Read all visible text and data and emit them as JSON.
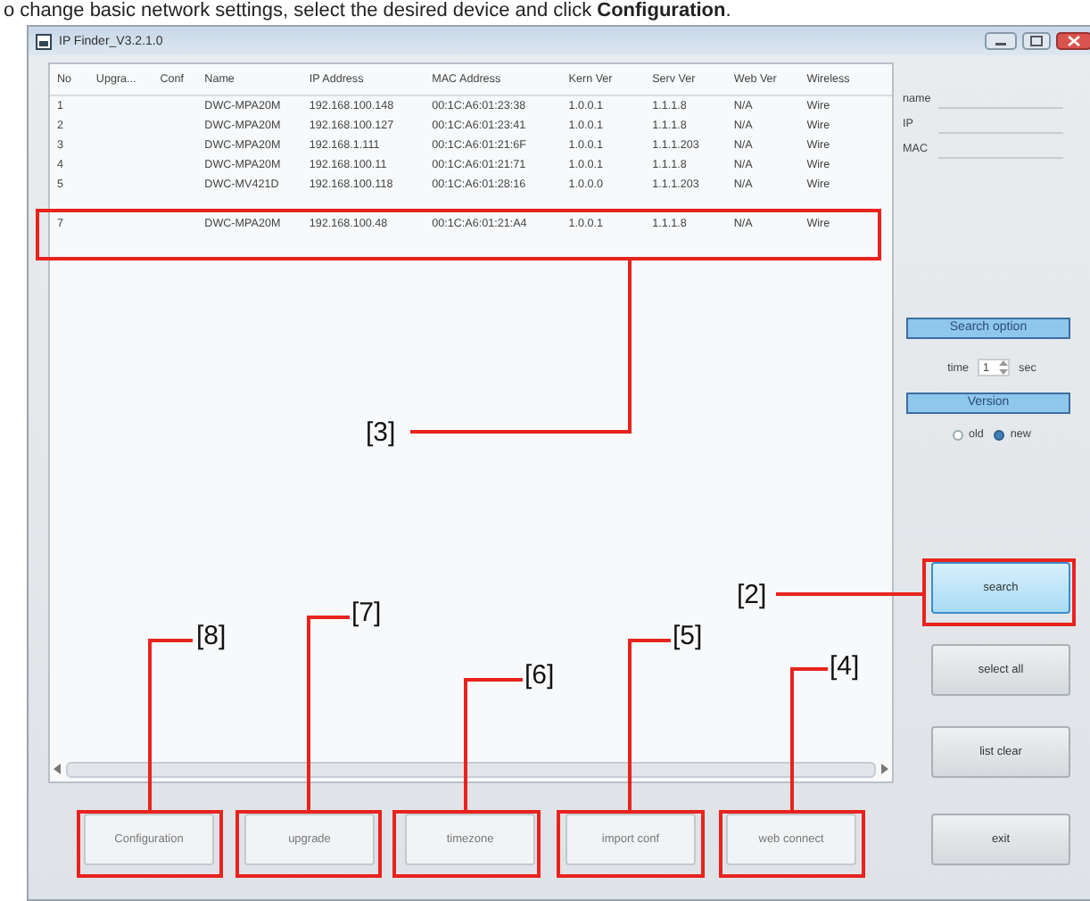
{
  "caption": "o change basic network settings, select the desired device and click **Configuration**.",
  "window": {
    "title": "IP Finder_V3.2.1.0"
  },
  "table": {
    "columns": [
      "No",
      "Upgra...",
      "Conf",
      "Name",
      "IP Address",
      "MAC Address",
      "Kern Ver",
      "Serv Ver",
      "Web Ver",
      "Wireless"
    ],
    "rows": [
      {
        "no": "1",
        "name": "DWC-MPA20M",
        "ip": "192.168.100.148",
        "mac": "00:1C:A6:01:23:38",
        "kern": "1.0.0.1",
        "serv": "1.1.1.8",
        "web": "N/A",
        "wireless": "Wire"
      },
      {
        "no": "2",
        "name": "DWC-MPA20M",
        "ip": "192.168.100.127",
        "mac": "00:1C:A6:01:23:41",
        "kern": "1.0.0.1",
        "serv": "1.1.1.8",
        "web": "N/A",
        "wireless": "Wire"
      },
      {
        "no": "3",
        "name": "DWC-MPA20M",
        "ip": "192.168.1.111",
        "mac": "00:1C:A6:01:21:6F",
        "kern": "1.0.0.1",
        "serv": "1.1.1.203",
        "web": "N/A",
        "wireless": "Wire"
      },
      {
        "no": "4",
        "name": "DWC-MPA20M",
        "ip": "192.168.100.11",
        "mac": "00:1C:A6:01:21:71",
        "kern": "1.0.0.1",
        "serv": "1.1.1.8",
        "web": "N/A",
        "wireless": "Wire"
      },
      {
        "no": "5",
        "name": "DWC-MV421D",
        "ip": "192.168.100.118",
        "mac": "00:1C:A6:01:28:16",
        "kern": "1.0.0.0",
        "serv": "1.1.1.203",
        "web": "N/A",
        "wireless": "Wire"
      },
      {
        "no": "7",
        "name": "DWC-MPA20M",
        "ip": "192.168.100.48",
        "mac": "00:1C:A6:01:21:A4",
        "kern": "1.0.0.1",
        "serv": "1.1.1.8",
        "web": "N/A",
        "wireless": "Wire"
      }
    ]
  },
  "filters": [
    {
      "label": "name"
    },
    {
      "label": "IP"
    },
    {
      "label": "MAC"
    }
  ],
  "search_option": {
    "title": "Search option",
    "time_label": "time",
    "time_value": "1",
    "unit": "sec"
  },
  "version": {
    "title": "Version",
    "options": [
      {
        "label": "old",
        "selected": false
      },
      {
        "label": "new",
        "selected": true
      }
    ]
  },
  "side_buttons": [
    {
      "label": "search",
      "focused": true
    },
    {
      "label": "select all",
      "focused": false
    },
    {
      "label": "list clear",
      "focused": false
    },
    {
      "label": "exit",
      "focused": false
    }
  ],
  "bottom_buttons": [
    {
      "label": "Configuration"
    },
    {
      "label": "upgrade"
    },
    {
      "label": "timezone"
    },
    {
      "label": "import conf"
    },
    {
      "label": "web connect"
    }
  ],
  "callouts": [
    {
      "label": "[3]"
    },
    {
      "label": "[2]"
    },
    {
      "label": "[8]"
    },
    {
      "label": "[7]"
    },
    {
      "label": "[6]"
    },
    {
      "label": "[5]"
    },
    {
      "label": "[4]"
    }
  ]
}
